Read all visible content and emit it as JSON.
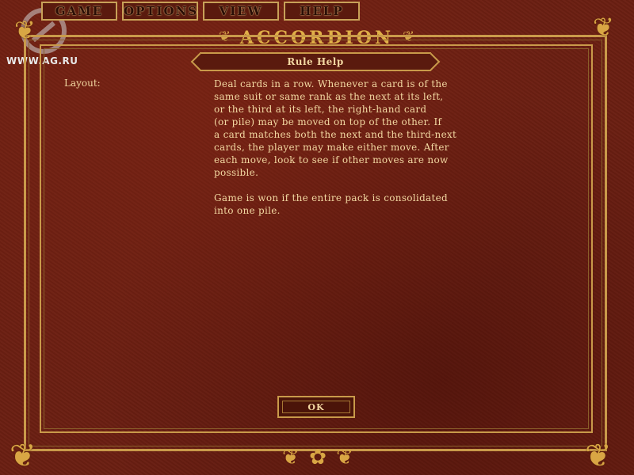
{
  "menu": {
    "items": [
      {
        "label": "GAME"
      },
      {
        "label": "OPTIONS"
      },
      {
        "label": "VIEW"
      },
      {
        "label": "HELP"
      }
    ]
  },
  "watermark": {
    "text": "WWW.AG.RU"
  },
  "header": {
    "title": "ACCORDION"
  },
  "dialog": {
    "title": "Rule Help",
    "label": "Layout:",
    "text": "Deal cards in a row.  Whenever a card is of the\nsame suit or same rank as the next at its left,\nor the third at its left, the right-hand card\n(or pile) may be moved on top of the other.  If\na card matches both the next and the third-next\ncards, the player may make either move.  After\neach move, look to see if other moves are now\npossible.\n\nGame is won if the entire pack is consolidated\ninto one pile.",
    "ok_label": "OK"
  },
  "colors": {
    "background": "#6b1f12",
    "gold": "#c99a4a",
    "text": "#f2d7a1"
  }
}
